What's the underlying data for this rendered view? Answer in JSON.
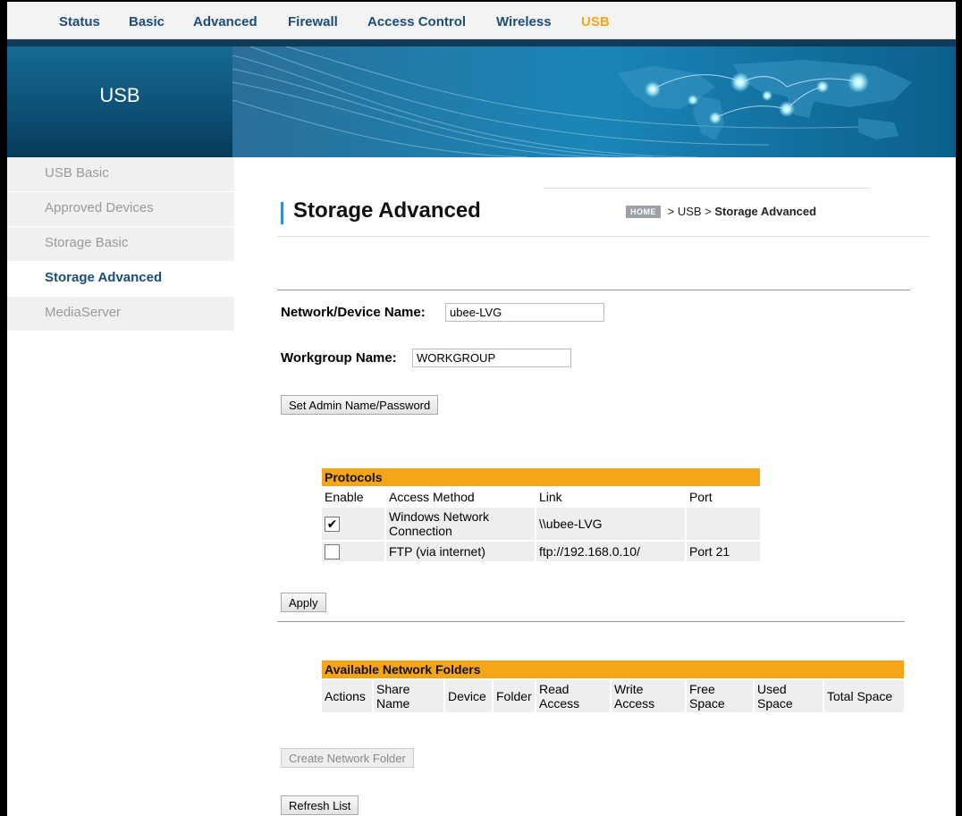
{
  "nav": {
    "items": [
      {
        "label": "Status",
        "active": false
      },
      {
        "label": "Basic",
        "active": false
      },
      {
        "label": "Advanced",
        "active": false
      },
      {
        "label": "Firewall",
        "active": false
      },
      {
        "label": "Access Control",
        "active": false
      },
      {
        "label": "Wireless",
        "active": false
      },
      {
        "label": "USB",
        "active": true
      }
    ]
  },
  "banner": {
    "title": "USB"
  },
  "sidebar": {
    "items": [
      {
        "label": "USB Basic",
        "active": false
      },
      {
        "label": "Approved Devices",
        "active": false
      },
      {
        "label": "Storage Basic",
        "active": false
      },
      {
        "label": "Storage Advanced",
        "active": true
      },
      {
        "label": "MediaServer",
        "active": false
      }
    ]
  },
  "page": {
    "title": "Storage Advanced"
  },
  "breadcrumb": {
    "home": "HOME",
    "sep1": " > ",
    "section": "USB",
    "sep2": " > ",
    "current": "Storage Advanced"
  },
  "form": {
    "device_name_label": "Network/Device Name:",
    "device_name_value": "ubee-LVG",
    "workgroup_label": "Workgroup Name:",
    "workgroup_value": "WORKGROUP",
    "set_admin_button": "Set Admin Name/Password",
    "apply_button": "Apply",
    "create_folder_button": "Create Network Folder",
    "refresh_button": "Refresh List"
  },
  "protocols": {
    "title": "Protocols",
    "columns": [
      "Enable",
      "Access Method",
      "Link",
      "Port"
    ],
    "rows": [
      {
        "checked": true,
        "method": "Windows Network Connection",
        "link": "\\\\ubee-LVG",
        "port": ""
      },
      {
        "checked": false,
        "method": "FTP (via internet)",
        "link": "ftp://192.168.0.10/",
        "port": "Port 21"
      }
    ]
  },
  "folders": {
    "title": "Available Network Folders",
    "columns": [
      "Actions",
      "Share Name",
      "Device",
      "Folder",
      "Read Access",
      "Write Access",
      "Free Space",
      "Used Space",
      "Total Space"
    ]
  },
  "colors": {
    "accent": "#f6a418",
    "nav_text": "#1b4d78",
    "banner": "#0d4e74"
  },
  "icons": {
    "checkmark": "checkmark-icon",
    "home": "home-badge"
  }
}
